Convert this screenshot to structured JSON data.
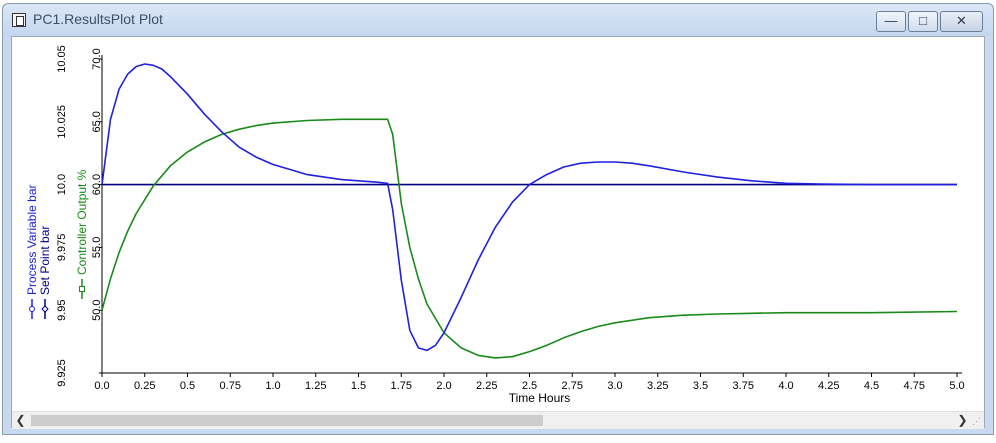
{
  "window": {
    "title": "PC1.ResultsPlot Plot",
    "buttons": {
      "minimize": "—",
      "maximize": "□",
      "close": "✕"
    }
  },
  "colors": {
    "process_variable": "#2020e0",
    "set_point": "#000080",
    "controller_output": "#1a8a1a"
  },
  "chart_data": {
    "type": "line",
    "xlabel": "Time Hours",
    "xlim": [
      0.0,
      5.0
    ],
    "x_ticks": [
      "0.0",
      "0.25",
      "0.5",
      "0.75",
      "1.0",
      "1.25",
      "1.5",
      "1.75",
      "2.0",
      "2.25",
      "2.5",
      "2.75",
      "3.0",
      "3.25",
      "3.5",
      "3.75",
      "4.0",
      "4.25",
      "4.5",
      "4.75",
      "5.0"
    ],
    "left_axis": {
      "labels": [
        "Process Variable bar",
        "Set Point bar"
      ],
      "ylim": [
        9.925,
        10.05
      ],
      "ticks": [
        "9.925",
        "9.95",
        "9.975",
        "10.0",
        "10.025",
        "10.05"
      ]
    },
    "right_axis": {
      "label": "Controller Output %",
      "ylim": [
        45.0,
        70.0
      ],
      "ticks": [
        "50.0",
        "55.0",
        "60.0",
        "65.0",
        "70.0"
      ]
    },
    "series": [
      {
        "name": "Process Variable bar",
        "axis": "left",
        "x": [
          0,
          0.05,
          0.1,
          0.15,
          0.2,
          0.25,
          0.3,
          0.35,
          0.4,
          0.5,
          0.6,
          0.7,
          0.8,
          0.9,
          1.0,
          1.1,
          1.2,
          1.3,
          1.4,
          1.5,
          1.6,
          1.67,
          1.7,
          1.75,
          1.8,
          1.85,
          1.9,
          1.95,
          2.0,
          2.1,
          2.2,
          2.3,
          2.4,
          2.5,
          2.6,
          2.7,
          2.8,
          2.9,
          3.0,
          3.1,
          3.2,
          3.4,
          3.6,
          3.8,
          4.0,
          4.2,
          4.5,
          5.0
        ],
        "y": [
          10.0,
          10.026,
          10.038,
          10.044,
          10.047,
          10.048,
          10.0475,
          10.046,
          10.043,
          10.036,
          10.028,
          10.021,
          10.015,
          10.011,
          10.008,
          10.006,
          10.004,
          10.003,
          10.002,
          10.0015,
          10.001,
          10.0005,
          9.99,
          9.962,
          9.942,
          9.935,
          9.934,
          9.936,
          9.941,
          9.955,
          9.97,
          9.983,
          9.993,
          10.0,
          10.004,
          10.007,
          10.0085,
          10.009,
          10.009,
          10.0085,
          10.0075,
          10.005,
          10.003,
          10.0015,
          10.0005,
          10.0002,
          10.0,
          10.0
        ]
      },
      {
        "name": "Set Point bar",
        "axis": "left",
        "x": [
          0,
          5.0
        ],
        "y": [
          10.0,
          10.0
        ]
      },
      {
        "name": "Controller Output %",
        "axis": "right",
        "x": [
          0,
          0.05,
          0.1,
          0.15,
          0.2,
          0.3,
          0.4,
          0.5,
          0.6,
          0.7,
          0.8,
          0.9,
          1.0,
          1.2,
          1.4,
          1.6,
          1.67,
          1.7,
          1.75,
          1.8,
          1.85,
          1.9,
          2.0,
          2.1,
          2.2,
          2.3,
          2.4,
          2.5,
          2.6,
          2.7,
          2.8,
          2.9,
          3.0,
          3.2,
          3.4,
          3.6,
          3.8,
          4.0,
          4.5,
          5.0
        ],
        "y": [
          50.0,
          52.5,
          54.6,
          56.3,
          57.7,
          59.9,
          61.5,
          62.6,
          63.4,
          64.0,
          64.4,
          64.7,
          64.9,
          65.1,
          65.2,
          65.2,
          65.2,
          64.0,
          58.5,
          55.0,
          52.5,
          50.5,
          48.2,
          47.0,
          46.4,
          46.2,
          46.3,
          46.7,
          47.2,
          47.8,
          48.3,
          48.7,
          49.0,
          49.4,
          49.6,
          49.7,
          49.75,
          49.8,
          49.8,
          49.9
        ]
      }
    ]
  }
}
